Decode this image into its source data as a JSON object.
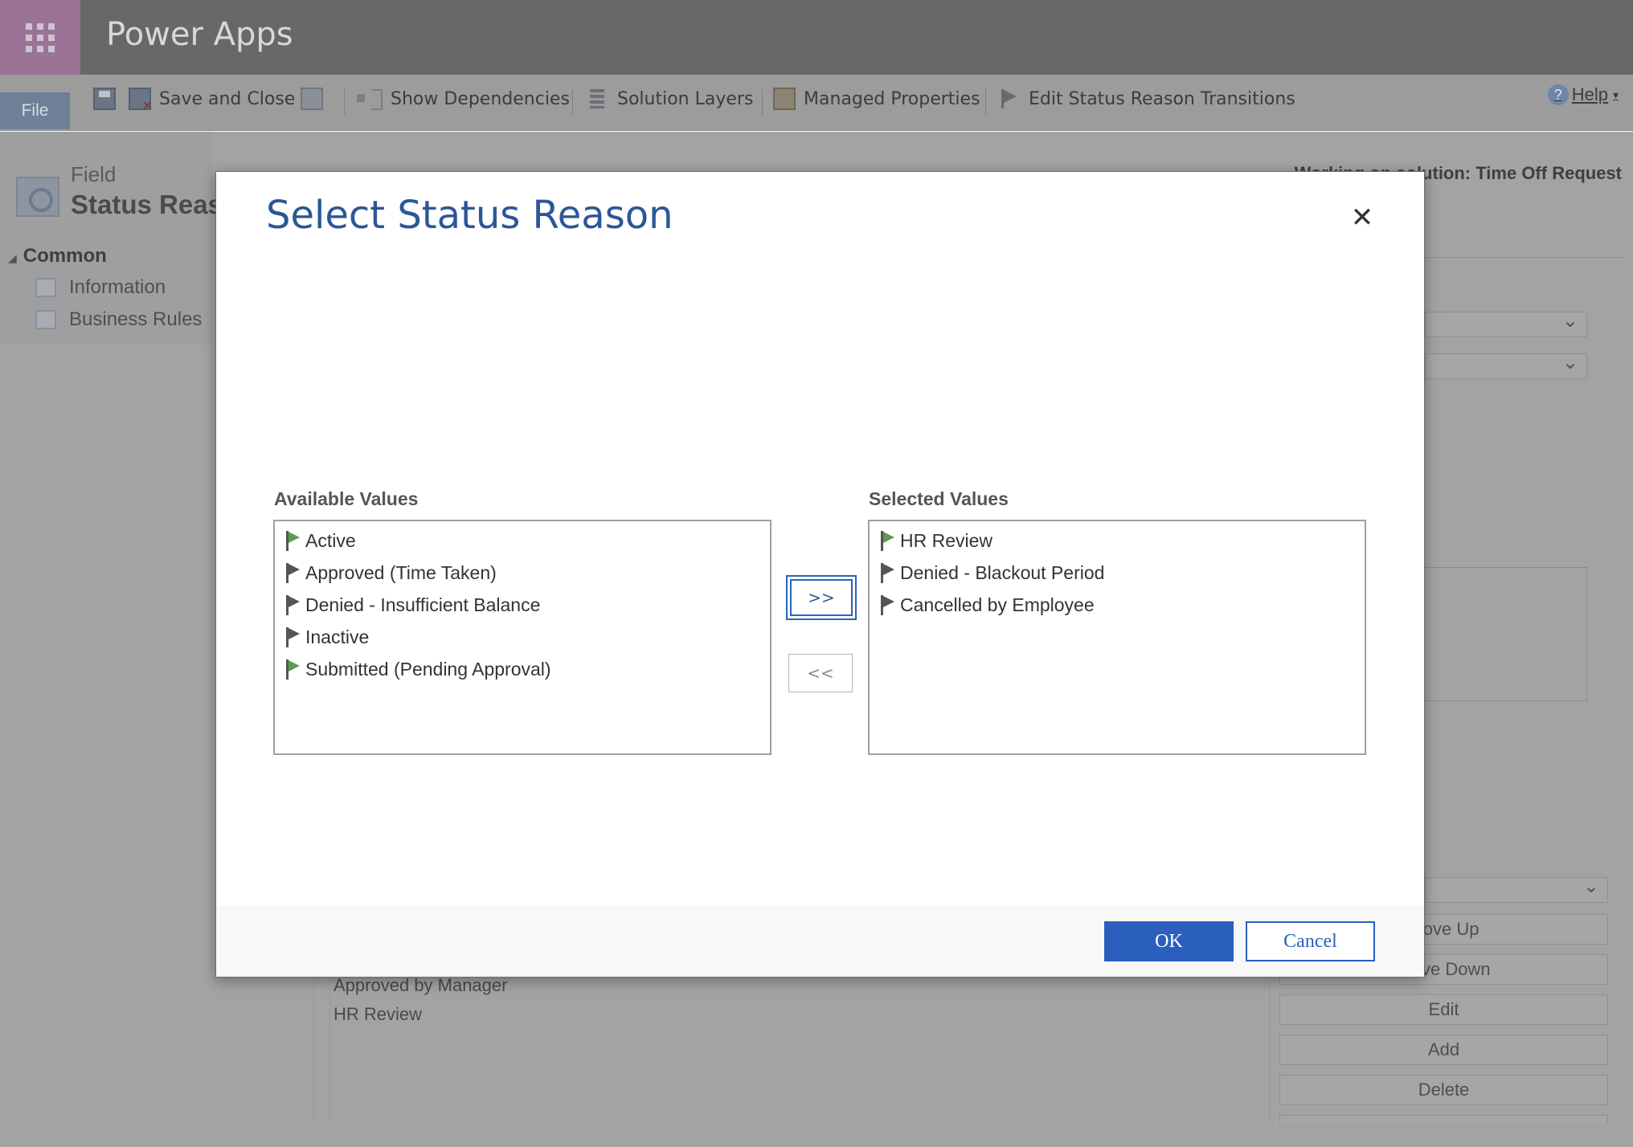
{
  "app": {
    "title": "Power Apps",
    "launcher_icon": "waffle-icon"
  },
  "ribbon": {
    "file_tab": "File",
    "save_and_close": "Save and Close",
    "show_dependencies": "Show Dependencies",
    "solution_layers": "Solution Layers",
    "managed_properties": "Managed Properties",
    "edit_status_reason_transitions": "Edit Status Reason Transitions",
    "help": "Help"
  },
  "page": {
    "entity_type": "Field",
    "field_name": "Status Reas",
    "working_solution": "Working on solution: Time Off Request",
    "nav": {
      "group": "Common",
      "items": [
        "Information",
        "Business Rules"
      ]
    },
    "background_list": [
      "Approved by Manager",
      "HR Review"
    ],
    "background_buttons": [
      "Move Up",
      "Move Down",
      "Edit",
      "Add",
      "Delete"
    ]
  },
  "dialog": {
    "title": "Select Status Reason",
    "available_label": "Available Values",
    "selected_label": "Selected Values",
    "available_values": [
      {
        "label": "Active",
        "flag_color": "#5b9b4f"
      },
      {
        "label": "Approved (Time Taken)",
        "flag_color": "#555555"
      },
      {
        "label": "Denied - Insufficient Balance",
        "flag_color": "#555555"
      },
      {
        "label": "Inactive",
        "flag_color": "#555555"
      },
      {
        "label": "Submitted (Pending Approval)",
        "flag_color": "#5b9b4f"
      }
    ],
    "selected_values": [
      {
        "label": "HR Review",
        "flag_color": "#5b9b4f"
      },
      {
        "label": "Denied - Blackout Period",
        "flag_color": "#555555"
      },
      {
        "label": "Cancelled by Employee",
        "flag_color": "#555555"
      }
    ],
    "add_button": ">>",
    "remove_button": "<<",
    "ok_button": "OK",
    "cancel_button": "Cancel",
    "accent_color": "#2b5fbd"
  }
}
